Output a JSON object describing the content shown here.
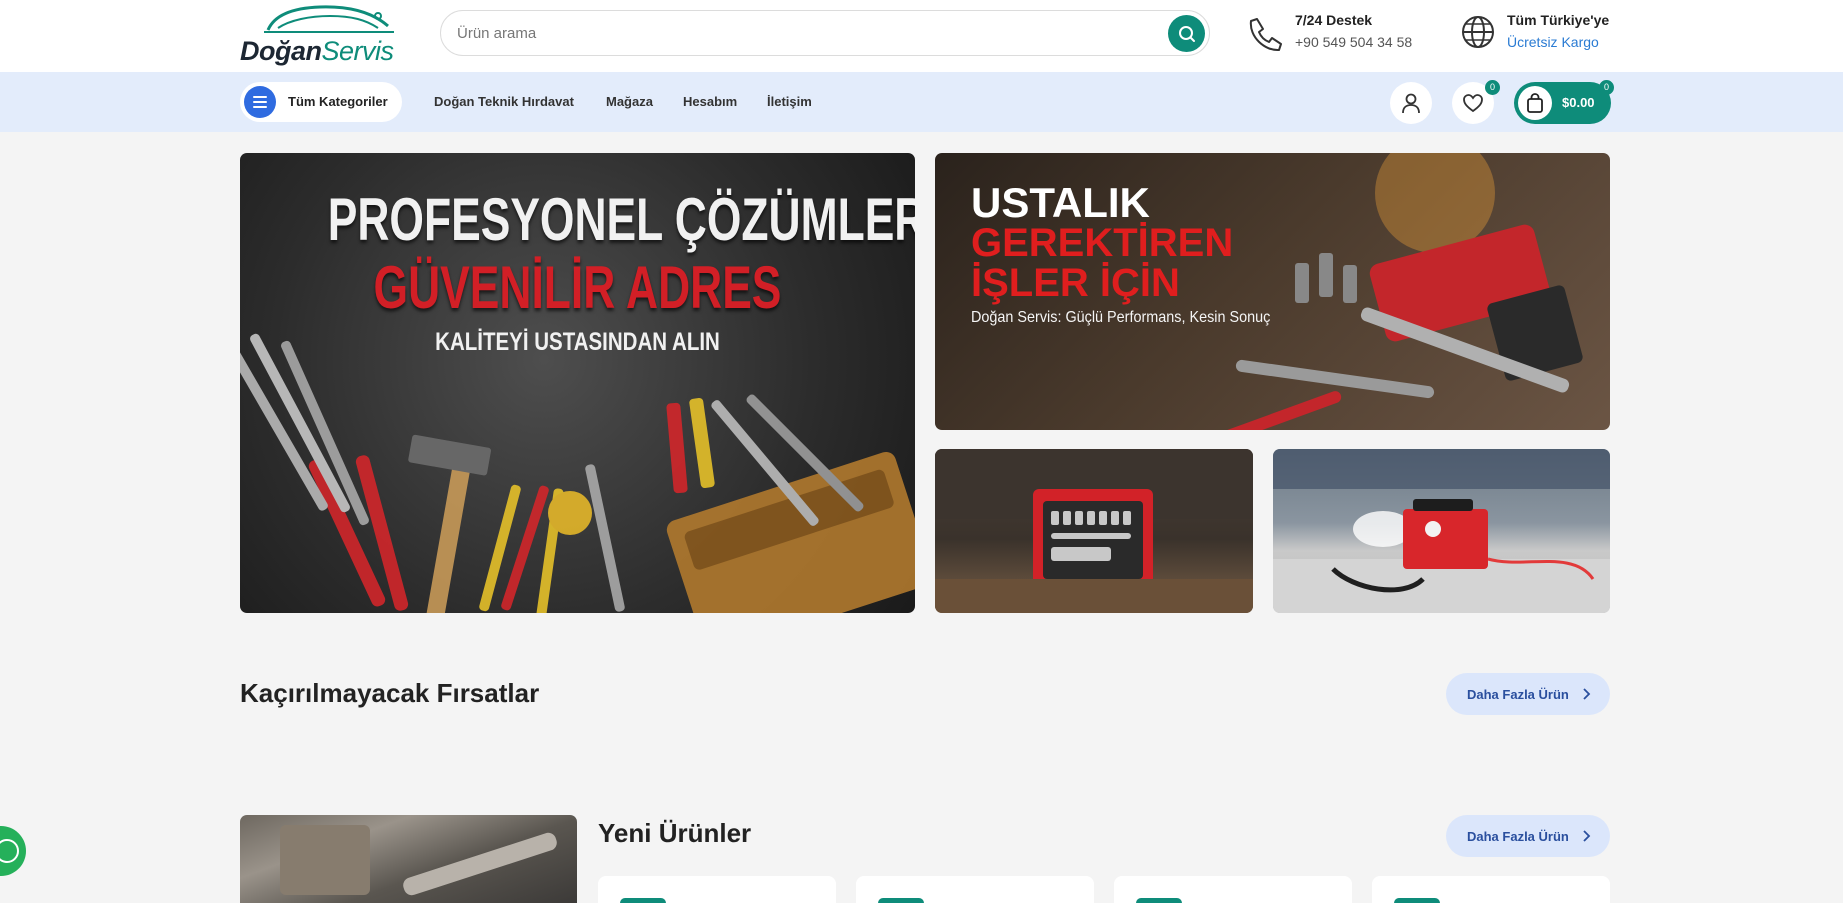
{
  "brand": {
    "name_part1": "Doğan",
    "name_part2": "Servis",
    "primary_color": "#0e8c7a",
    "accent_color": "#2f6be0"
  },
  "search": {
    "placeholder": "Ürün arama",
    "button_icon": "search-icon"
  },
  "header_info": {
    "support_title": "7/24 Destek",
    "support_phone": "+90 549 504 34 58",
    "support_icon": "phone-hand-icon",
    "shipping_title": "Tüm Türkiye'ye",
    "shipping_subtitle": "Ücretsiz Kargo",
    "shipping_icon": "globe-icon"
  },
  "nav": {
    "categories_label": "Tüm Kategoriler",
    "links": [
      "Doğan Teknik Hırdavat",
      "Mağaza",
      "Hesabım",
      "İletişim"
    ],
    "wishlist_count": "0",
    "cart_count": "0",
    "cart_total": "$0.00"
  },
  "banners": {
    "main": {
      "line1": "PROFESYONEL ÇÖZÜMLER,",
      "line2": "GÜVENİLİR ADRES",
      "line3": "KALİTEYİ USTASINDAN ALIN"
    },
    "top_right": {
      "line1": "USTALIK",
      "line2": "GEREKTİREN",
      "line3": "İŞLER İÇİN",
      "line4": "Doğan Servis: Güçlü Performans, Kesin Sonuç"
    }
  },
  "sections": {
    "deals_title": "Kaçırılmayacak Fırsatlar",
    "deals_more": "Daha Fazla Ürün",
    "new_title": "Yeni Ürünler",
    "new_more": "Daha Fazla Ürün"
  }
}
